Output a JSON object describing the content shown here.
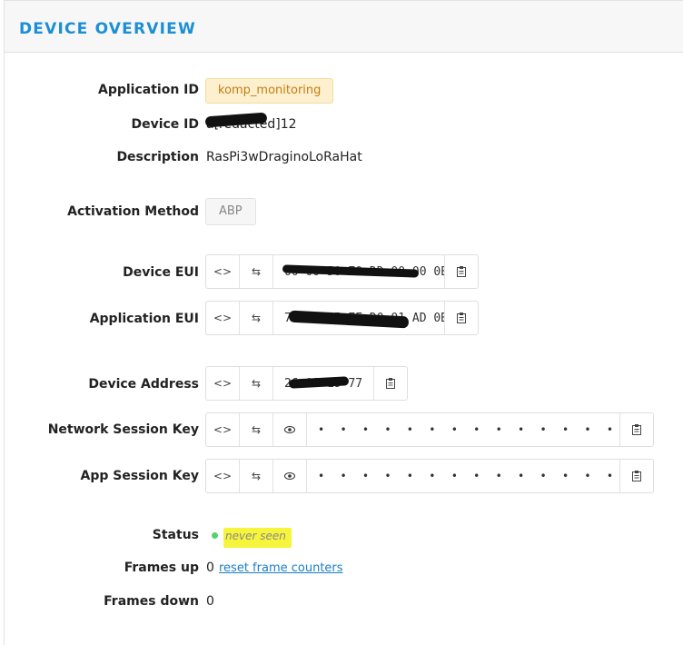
{
  "header": {
    "title": "DEVICE OVERVIEW"
  },
  "fields": {
    "application_id": {
      "label": "Application ID",
      "value": "komp_monitoring"
    },
    "device_id": {
      "label": "Device ID",
      "value": "a[redacted]12"
    },
    "description": {
      "label": "Description",
      "value": "RasPi3wDraginoLoRaHat"
    },
    "activation_method": {
      "label": "Activation Method",
      "value": "ABP"
    },
    "device_eui": {
      "label": "Device EUI",
      "value": "00 00 50 70 DD 00 00 0E"
    },
    "application_eui": {
      "label": "Application EUI",
      "value": "70 B3 D5 7E D0 01 AD 0B"
    },
    "device_address": {
      "label": "Device Address",
      "value": "26 01 19 77"
    },
    "network_session_key": {
      "label": "Network Session Key",
      "value": "• • • • • • • • • • • • • • • • • • • • • • • • • • • • • • • •"
    },
    "app_session_key": {
      "label": "App Session Key",
      "value": "• • • • • • • • • • • • • • • • • • • • • • • • • • • • • • • •"
    },
    "status": {
      "label": "Status",
      "value": "never seen"
    },
    "frames_up": {
      "label": "Frames up",
      "value": "0",
      "link": "reset frame counters"
    },
    "frames_down": {
      "label": "Frames down",
      "value": "0"
    }
  },
  "icons": {
    "code": "code-toggle-icon",
    "swap": "byte-order-swap-icon",
    "eye": "eye-icon",
    "copy": "clipboard-copy-icon"
  },
  "colors": {
    "title": "#1a8fd6",
    "tag_bg": "#fdf0cf",
    "tag_text": "#c57d12",
    "status_dot": "#54d36b",
    "highlight": "#f7f53b",
    "link": "#1a7fc6"
  }
}
